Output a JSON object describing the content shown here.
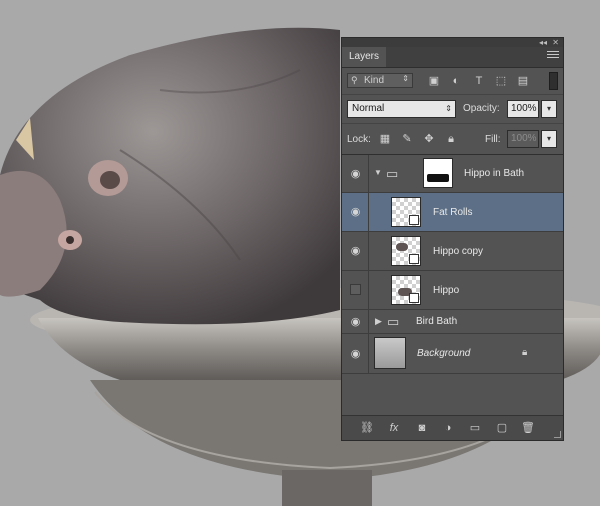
{
  "panel": {
    "title": "Layers",
    "collapse_label": "◂◂",
    "close_label": "✕"
  },
  "filter": {
    "kind_label": "Kind",
    "icons": [
      "image-filter-icon",
      "adjustment-filter-icon",
      "type-filter-icon",
      "shape-filter-icon",
      "smart-object-filter-icon"
    ]
  },
  "blend": {
    "mode": "Normal",
    "opacity_label": "Opacity:",
    "opacity_value": "100%"
  },
  "lock": {
    "label": "Lock:",
    "fill_label": "Fill:",
    "fill_value": "100%"
  },
  "layers": [
    {
      "name": "Hippo in Bath",
      "type": "group",
      "visible": true,
      "expanded": true
    },
    {
      "name": "Fat Rolls",
      "type": "smart-object",
      "visible": true,
      "selected": true
    },
    {
      "name": "Hippo copy",
      "type": "smart-object",
      "visible": true
    },
    {
      "name": "Hippo",
      "type": "smart-object",
      "visible": false
    },
    {
      "name": "Bird Bath",
      "type": "group",
      "visible": true,
      "expanded": false
    },
    {
      "name": "Background",
      "type": "background",
      "visible": true,
      "locked": true
    }
  ],
  "bottom_icons": [
    "link-layers-icon",
    "fx-icon",
    "add-mask-icon",
    "adjustment-layer-icon",
    "new-group-icon",
    "new-layer-icon",
    "delete-icon"
  ],
  "colors": {
    "panel_bg": "#535353",
    "selected_row": "#5c6f86",
    "canvas_bg": "#a9a9a9"
  }
}
